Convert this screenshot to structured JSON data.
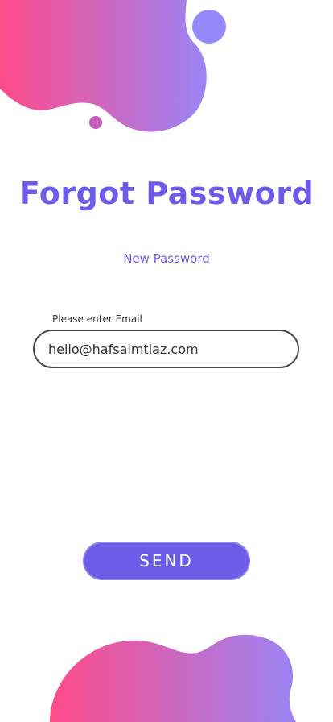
{
  "page": {
    "title": "Forgot Password",
    "subtitle": "New Password"
  },
  "form": {
    "email_label": "Please enter Email",
    "email_value": "hello@hafsaimtiaz.com",
    "send_label": "SEND"
  },
  "colors": {
    "accent": "#6c5ce7",
    "gradient_start": "#ff4b8a",
    "gradient_end": "#9b84f5",
    "dot_small": "#c55ab9"
  }
}
